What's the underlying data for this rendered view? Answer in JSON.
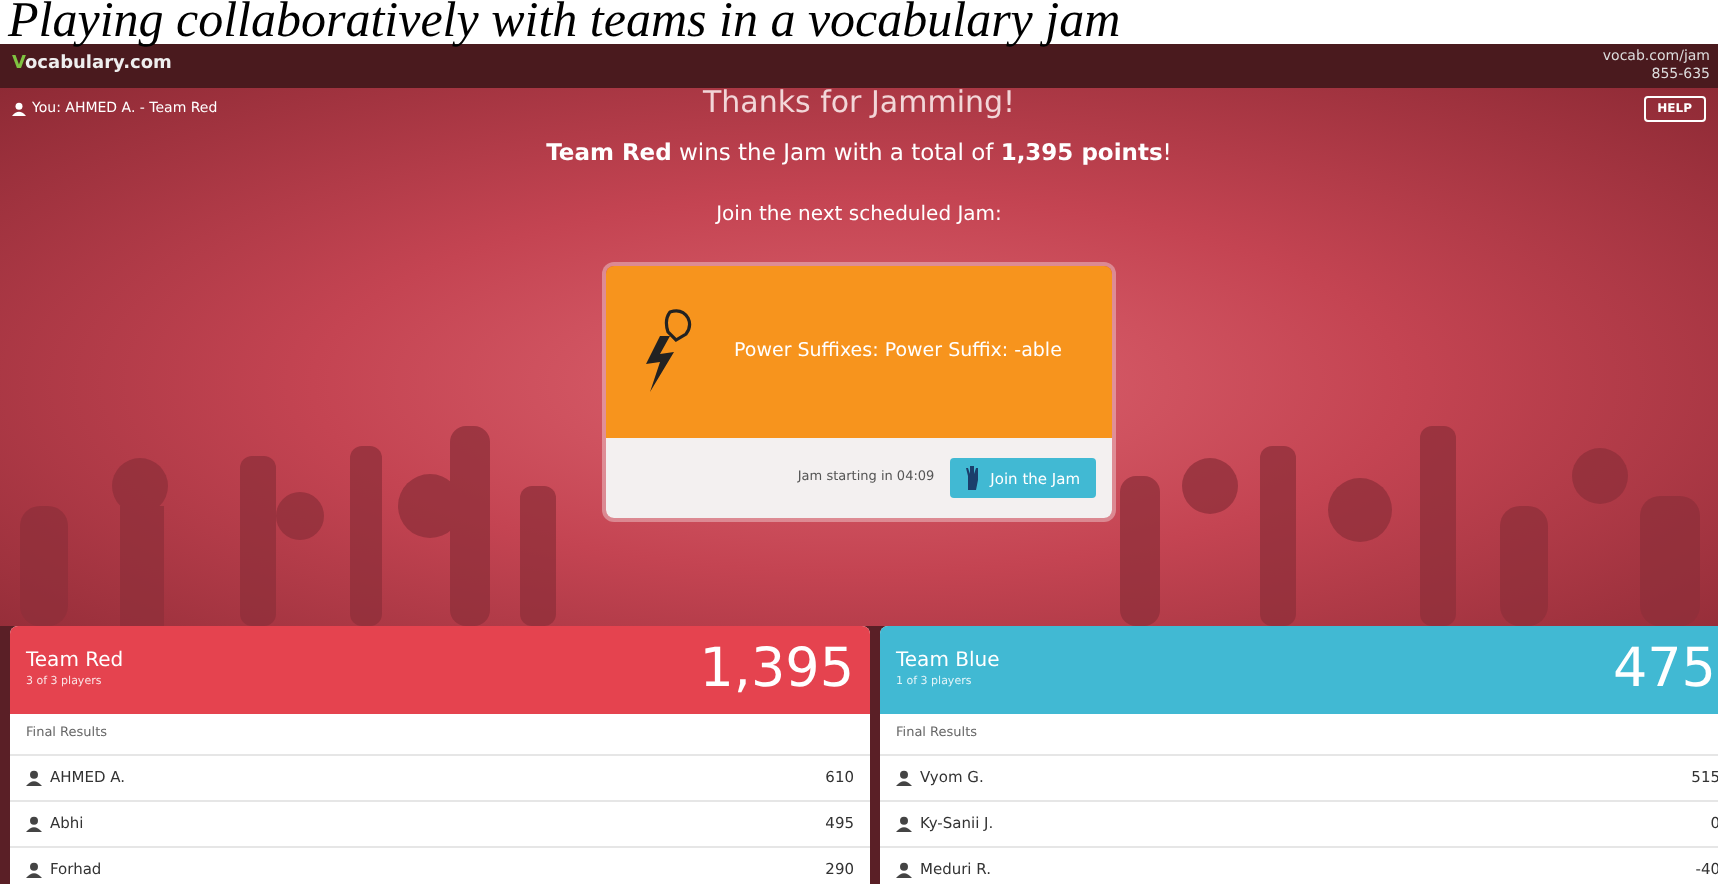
{
  "caption": "Playing collaboratively with teams in a vocabulary jam",
  "header": {
    "logo": "Vocabulary.com",
    "contact": [
      "vocab.com/jam",
      "855-635"
    ]
  },
  "user_bar": {
    "user": "You: AHMED A. - Team Red",
    "title": "Thanks for Jamming!",
    "help": "HELP"
  },
  "winner": "**Team Red** wins the Jam with a total of **1,395 points**!",
  "next_label": "Join the next scheduled Jam:",
  "jam_card": {
    "title": "Power Suffixes: Power Suffix: -able",
    "countdown": "Jam starting in 04:09",
    "button": "Join the Jam"
  },
  "teams": [
    {
      "name": "Team Red",
      "players": "3 of 3 players",
      "score": "1,395",
      "color": "#e5434f",
      "results_label": "Final Results",
      "members": [
        {
          "name": "AHMED A.",
          "score": "610"
        },
        {
          "name": "Abhi",
          "score": "495"
        },
        {
          "name": "Forhad",
          "score": "290"
        }
      ]
    },
    {
      "name": "Team Blue",
      "players": "1 of 3 players",
      "score": "475",
      "color": "#41b9d3",
      "results_label": "Final Results",
      "members": [
        {
          "name": "Vyom G.",
          "score": "515"
        },
        {
          "name": "Ky-Sanii J.",
          "score": "0"
        },
        {
          "name": "Meduri R.",
          "score": "-40"
        }
      ]
    }
  ]
}
